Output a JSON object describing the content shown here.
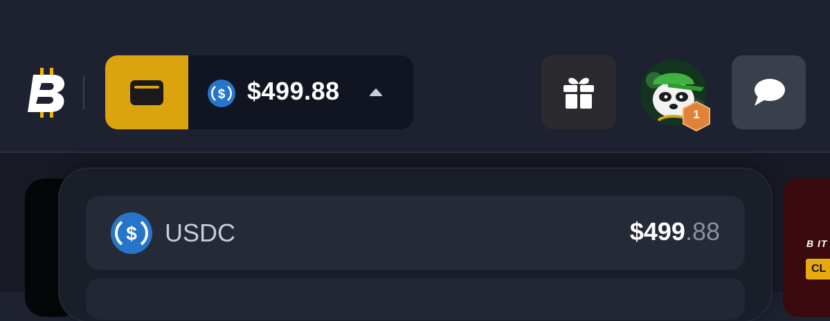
{
  "header": {
    "logo_icon": "bitcoin-b-logo",
    "wallet": {
      "icon": "wallet-icon",
      "currency_icon": "usdc-coin-icon",
      "balance": "$499.88",
      "toggle_icon": "caret-up-icon",
      "accent_color": "#dba40e"
    },
    "gift_icon": "gift-icon",
    "avatar": {
      "level": "1",
      "badge_color": "#e0823a"
    },
    "chat_icon": "chat-bubble-icon"
  },
  "currency_dropdown": {
    "items": [
      {
        "icon": "usdc-coin-icon",
        "name": "USDC",
        "amount_int": "$499",
        "amount_dec": ".88"
      }
    ]
  },
  "promo": {
    "button_label": "CL"
  }
}
